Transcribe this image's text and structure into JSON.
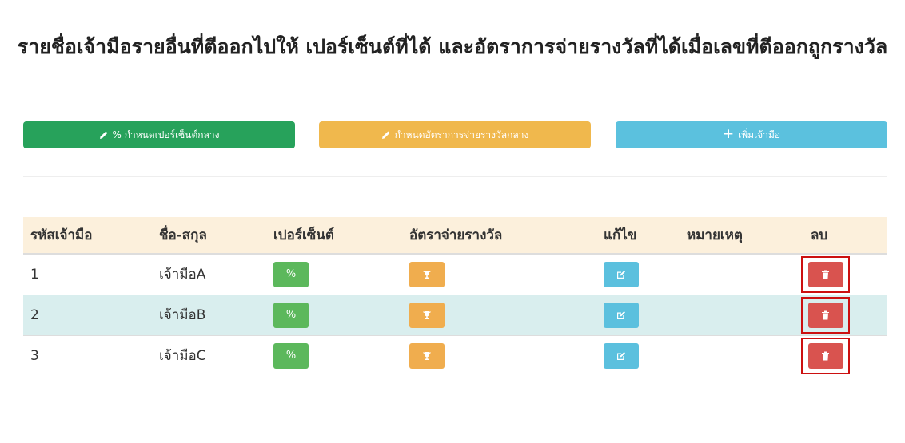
{
  "page": {
    "title": "รายชื่อเจ้ามือรายอื่นที่ตีออกไปให้ เปอร์เซ็นต์ที่ได้ และอัตราการจ่ายรางวัลที่ได้เมื่อเลขที่ตีออกถูกรางวัล"
  },
  "actions": {
    "set_percent": "% กำหนดเปอร์เซ็นต์กลาง",
    "set_rate": "กำหนดอัตราการจ่ายรางวัลกลาง",
    "add_dealer": "เพิ่มเจ้ามือ"
  },
  "table": {
    "headers": [
      "รหัสเจ้ามือ",
      "ชื่อ-สกุล",
      "เปอร์เซ็นต์",
      "อัตราจ่ายรางวัล",
      "แก้ไข",
      "หมายเหตุ",
      "ลบ"
    ],
    "rows": [
      {
        "id": "1",
        "name": "เจ้ามือA",
        "percent_btn": "%",
        "note": ""
      },
      {
        "id": "2",
        "name": "เจ้ามือB",
        "percent_btn": "%",
        "note": ""
      },
      {
        "id": "3",
        "name": "เจ้ามือC",
        "percent_btn": "%",
        "note": ""
      }
    ]
  },
  "colors": {
    "green": "#27a25b",
    "orange": "#f0b84d",
    "blue": "#5bc1de",
    "red": "#d9534f",
    "header_bg": "#fcf0dc",
    "alt_row_bg": "#d9eeee",
    "highlight_border": "#cc1010"
  },
  "icons": {
    "set_percent": "pencil-icon",
    "set_rate": "pencil-icon",
    "add_dealer": "plus-icon",
    "rate_cell": "trophy-icon",
    "edit_cell": "edit-icon",
    "delete_cell": "trash-icon"
  }
}
